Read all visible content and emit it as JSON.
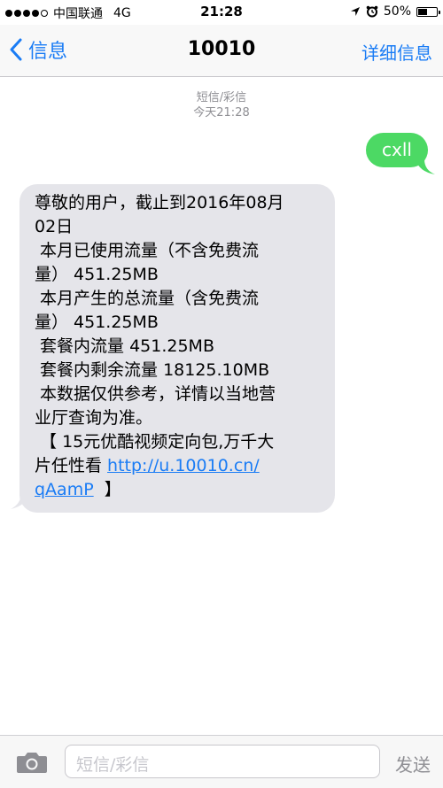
{
  "status_bar": {
    "carrier": "中国联通",
    "network": "4G",
    "time": "21:28",
    "battery": "50%",
    "battery_level": 0.5,
    "signal_bars": 4,
    "icons": [
      "signal-dots-icon",
      "location-arrow-icon",
      "alarm-clock-icon",
      "battery-icon"
    ]
  },
  "nav": {
    "back_label": "信息",
    "title": "10010",
    "details_label": "详细信息"
  },
  "thread_meta": {
    "service": "短信/彩信",
    "timestamp": "今天21:28"
  },
  "sent_message": {
    "text": "cxll",
    "color": "#4cd964"
  },
  "received_message": {
    "lines": [
      "尊敬的用户，截止到2016年08月",
      "02日",
      " 本月已使用流量（不含免费流",
      "量） 451.25MB",
      " 本月产生的总流量（含免费流",
      "量） 451.25MB",
      " 套餐内流量 451.25MB",
      " 套餐内剩余流量 18125.10MB",
      " 本数据仅供参考，详情以当地营",
      "业厅查询为准。",
      " 【 15元优酷视频定向包,万千大",
      "片任性看 "
    ],
    "link_part1": "http://u.10010.cn/",
    "link_part2": "qAamP",
    "closing": "  】",
    "color": "#e5e5ea"
  },
  "input_bar": {
    "placeholder": "短信/彩信",
    "send_label": "发送",
    "camera_icon": "camera-icon"
  },
  "accent_color": "#1a7cf5"
}
